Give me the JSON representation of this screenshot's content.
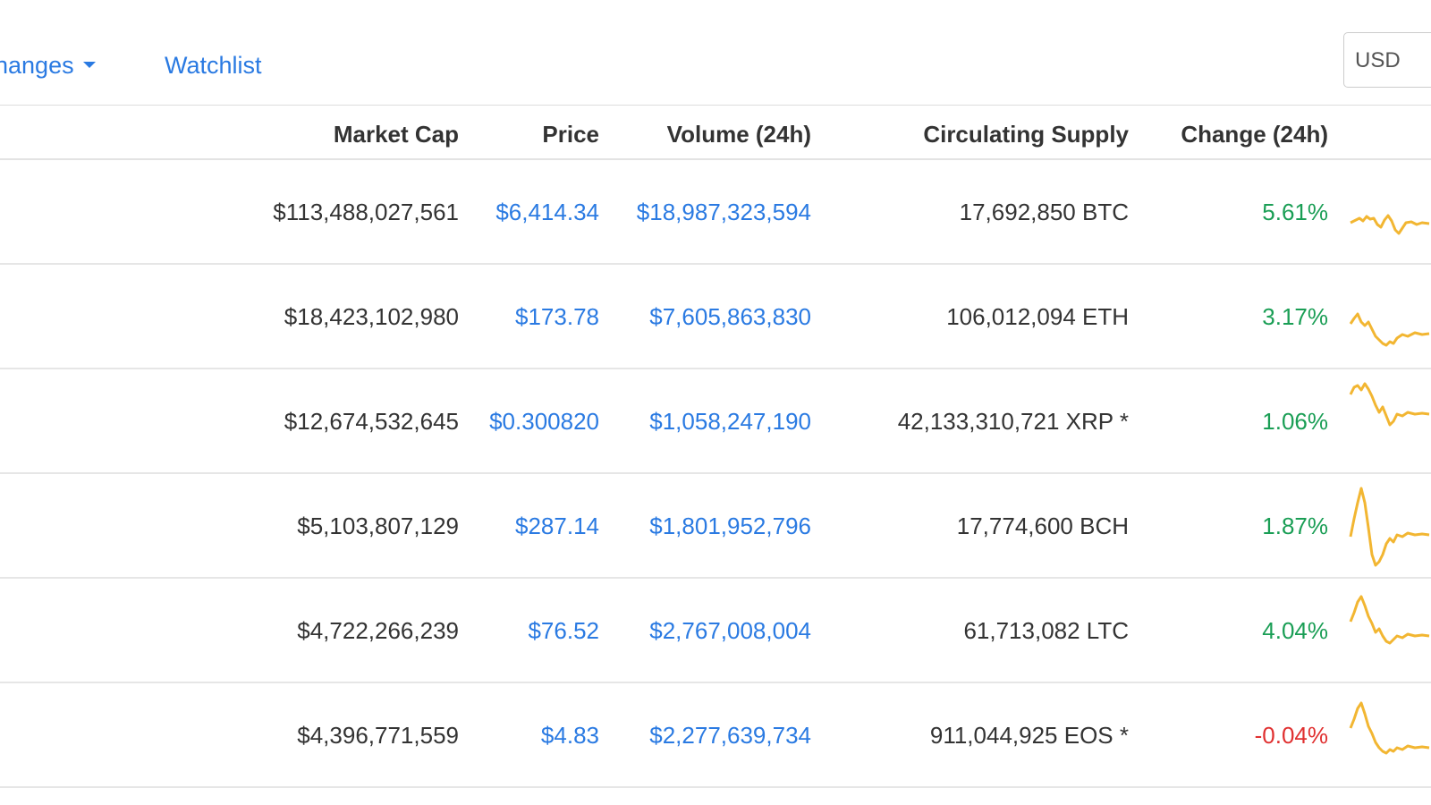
{
  "nav": {
    "exchanges_label": "hanges",
    "watchlist_label": "Watchlist",
    "currency_value": "USD"
  },
  "table": {
    "headers": {
      "market_cap": "Market Cap",
      "price": "Price",
      "volume": "Volume (24h)",
      "supply": "Circulating Supply",
      "change": "Change (24h)"
    },
    "rows": [
      {
        "market_cap": "$113,488,027,561",
        "price": "$6,414.34",
        "volume": "$18,987,323,594",
        "supply": "17,692,850 BTC",
        "change": "5.61%",
        "direction": "up"
      },
      {
        "market_cap": "$18,423,102,980",
        "price": "$173.78",
        "volume": "$7,605,863,830",
        "supply": "106,012,094 ETH",
        "change": "3.17%",
        "direction": "up"
      },
      {
        "market_cap": "$12,674,532,645",
        "price": "$0.300820",
        "volume": "$1,058,247,190",
        "supply": "42,133,310,721 XRP *",
        "change": "1.06%",
        "direction": "up"
      },
      {
        "market_cap": "$5,103,807,129",
        "price": "$287.14",
        "volume": "$1,801,952,796",
        "supply": "17,774,600 BCH",
        "change": "1.87%",
        "direction": "up"
      },
      {
        "market_cap": "$4,722,266,239",
        "price": "$76.52",
        "volume": "$2,767,008,004",
        "supply": "61,713,082 LTC",
        "change": "4.04%",
        "direction": "up"
      },
      {
        "market_cap": "$4,396,771,559",
        "price": "$4.83",
        "volume": "$2,277,639,734",
        "supply": "911,044,925 EOS *",
        "change": "-0.04%",
        "direction": "down"
      }
    ]
  },
  "colors": {
    "link": "#2a7ae2",
    "positive": "#1a9e55",
    "negative": "#e03030",
    "sparkline": "#f2b632"
  },
  "icons": {
    "dropdown": "caret-down-icon"
  }
}
